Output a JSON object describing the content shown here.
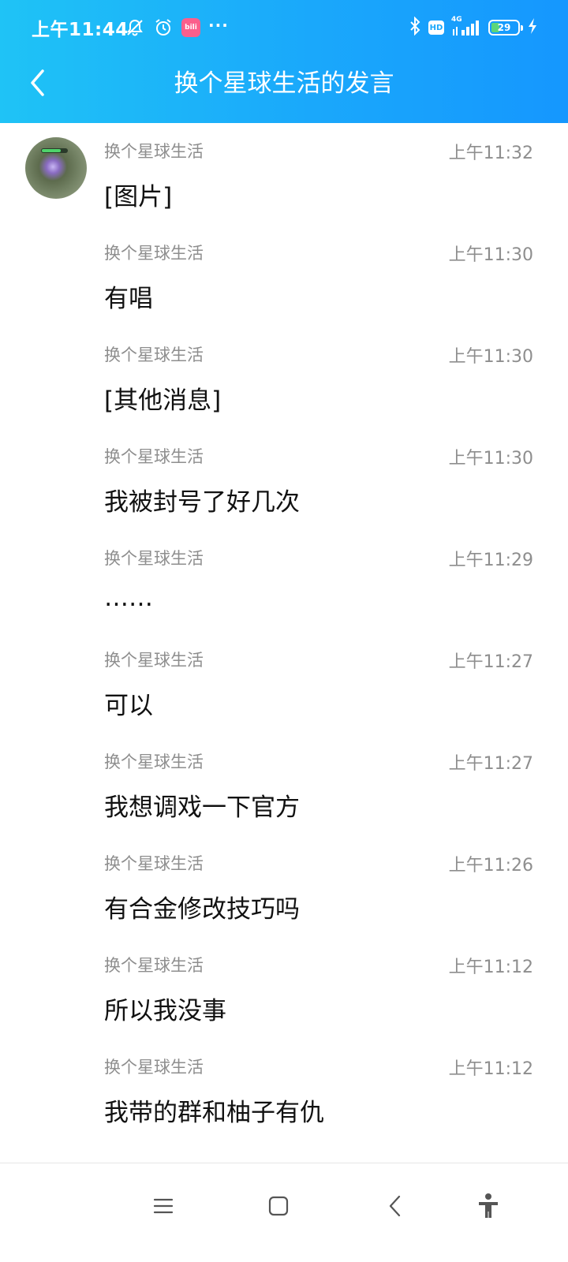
{
  "status_bar": {
    "time": "上午11:44",
    "network_label": "4G",
    "battery_level": "29",
    "left_icons": [
      "notification-muted-icon",
      "alarm-icon",
      "bilibili-app-icon",
      "more-dots-icon"
    ],
    "right_icons": [
      "bluetooth-icon",
      "hd-icon",
      "signal-icon",
      "battery-icon",
      "charging-icon"
    ],
    "app_badge_text": "bili",
    "more_text": "···",
    "hd_text": "HD"
  },
  "header": {
    "title": "换个星球生活的发言",
    "back_icon": "chevron-left-icon"
  },
  "colors": {
    "header_gradient_start": "#1fc3f6",
    "header_gradient_end": "#1597fe",
    "meta_text": "#8e8e8e",
    "message_text": "#111111"
  },
  "messages": [
    {
      "sender": "换个星球生活",
      "time": "上午11:32",
      "content": "[图片]"
    },
    {
      "sender": "换个星球生活",
      "time": "上午11:30",
      "content": "有唱"
    },
    {
      "sender": "换个星球生活",
      "time": "上午11:30",
      "content": "[其他消息]"
    },
    {
      "sender": "换个星球生活",
      "time": "上午11:30",
      "content": "我被封号了好几次"
    },
    {
      "sender": "换个星球生活",
      "time": "上午11:29",
      "content": "……"
    },
    {
      "sender": "换个星球生活",
      "time": "上午11:27",
      "content": "可以"
    },
    {
      "sender": "换个星球生活",
      "time": "上午11:27",
      "content": "我想调戏一下官方"
    },
    {
      "sender": "换个星球生活",
      "time": "上午11:26",
      "content": "有合金修改技巧吗"
    },
    {
      "sender": "换个星球生活",
      "time": "上午11:12",
      "content": "所以我没事"
    },
    {
      "sender": "换个星球生活",
      "time": "上午11:12",
      "content": "我带的群和柚子有仇"
    }
  ],
  "bottom_nav": {
    "items": [
      "menu-icon",
      "home-square-icon",
      "back-chevron-icon",
      "accessibility-icon"
    ]
  }
}
